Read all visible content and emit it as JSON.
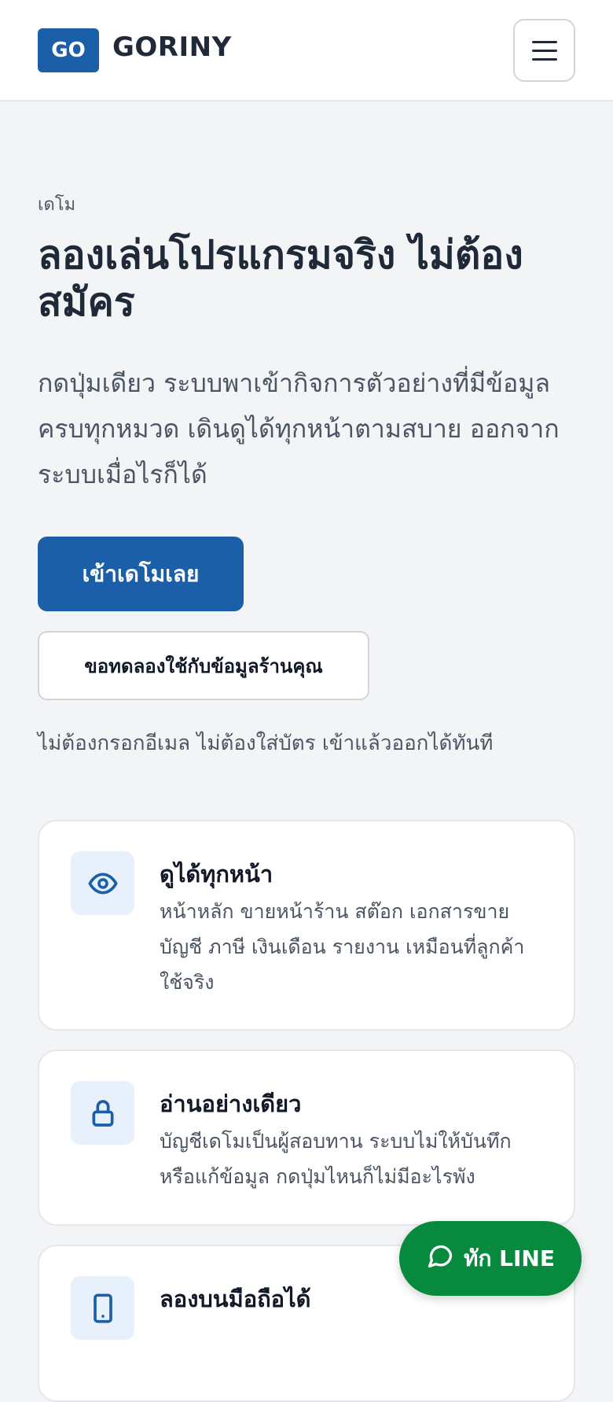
{
  "header": {
    "logo_badge": "GO",
    "logo_text": "GORINY",
    "menu_icon": "hamburger-menu-icon"
  },
  "hero": {
    "eyebrow": "เดโม",
    "title": "ลองเล่นโปรแกรมจริง ไม่ต้องสมัคร",
    "description": "กดปุ่มเดียว ระบบพาเข้ากิจการตัวอย่างที่มีข้อมูลครบทุกหมวด เดินดูได้ทุกหน้าตามสบาย ออกจากระบบเมื่อไรก็ได้",
    "primary_button": "เข้าเดโมเลย",
    "secondary_button": "ขอทดลองใช้กับข้อมูลร้านคุณ",
    "note": "ไม่ต้องกรอกอีเมล ไม่ต้องใส่บัตร เข้าแล้วออกได้ทันที"
  },
  "features": [
    {
      "icon": "eye-icon",
      "title": "ดูได้ทุกหน้า",
      "text": "หน้าหลัก ขายหน้าร้าน สต๊อก เอกสารขาย บัญชี ภาษี เงินเดือน รายงาน เหมือนที่ลูกค้าใช้จริง"
    },
    {
      "icon": "lock-icon",
      "title": "อ่านอย่างเดียว",
      "text": "บัญชีเดโมเป็นผู้สอบทาน ระบบไม่ให้บันทึกหรือแก้ข้อมูล กดปุ่มไหนก็ไม่มีอะไรพัง"
    },
    {
      "icon": "mobile-phone-icon",
      "title": "ลองบนมือถือได้",
      "text": ""
    }
  ],
  "line_button": {
    "icon": "chat-bubble-icon",
    "label": "ทัก LINE"
  },
  "colors": {
    "brand": "#1b5fa8",
    "line_green": "#078a3d",
    "background": "#f3f4f6"
  }
}
